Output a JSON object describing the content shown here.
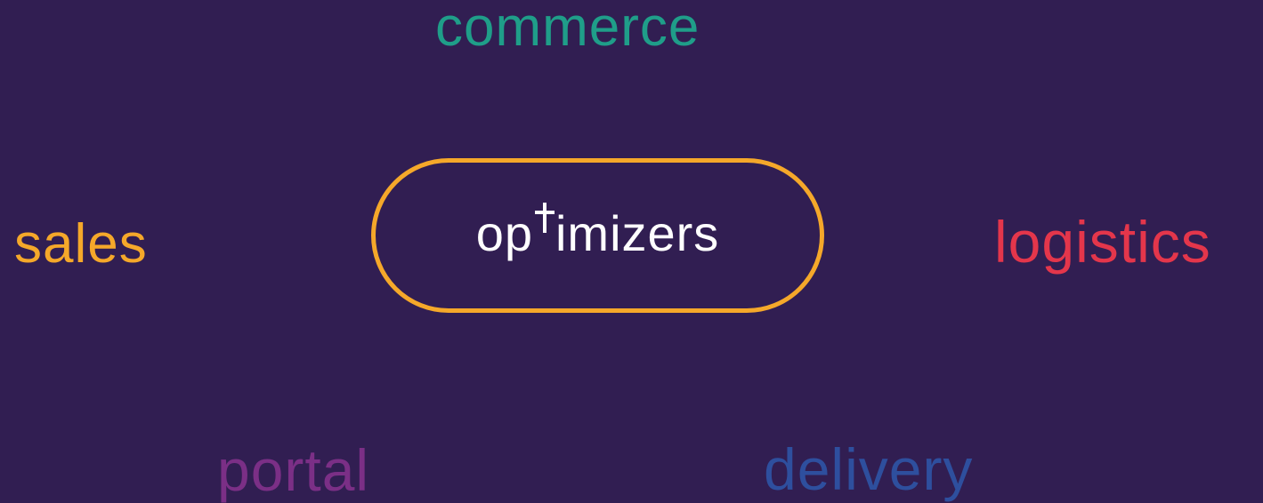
{
  "words": {
    "commerce": "commerce",
    "sales": "sales",
    "logistics": "logistics",
    "portal": "portal",
    "delivery": "delivery"
  },
  "logo": {
    "part1": "op",
    "part2": "imizers",
    "cross_icon": "plus-cross-icon"
  },
  "colors": {
    "background": "#311e52",
    "commerce": "#1f9e89",
    "sales": "#f5a82a",
    "logistics": "#e4364b",
    "portal": "#7b2f86",
    "delivery": "#2e4f9e",
    "pill_border": "#f5a82a",
    "logo_text": "#ffffff"
  }
}
